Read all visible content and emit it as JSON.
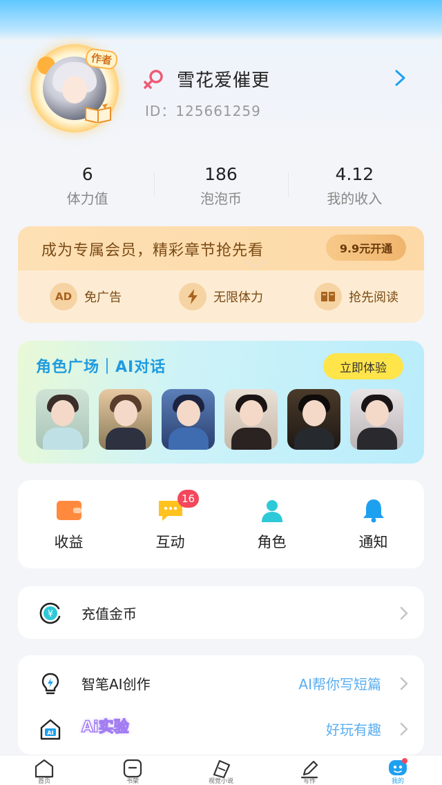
{
  "colors": {
    "accent": "#1ea0f0",
    "vip_text": "#7a4a14",
    "badge_red": "#f4475b",
    "ai_yellow": "#ffe44a",
    "link_blue": "#5aaef0"
  },
  "profile": {
    "avatar_badge": "作者",
    "gender_icon": "female-icon",
    "username": "雪花爱催更",
    "user_id": "ID：125661259"
  },
  "stats": [
    {
      "value": "6",
      "label": "体力值"
    },
    {
      "value": "186",
      "label": "泡泡币"
    },
    {
      "value": "4.12",
      "label": "我的收入"
    }
  ],
  "vip": {
    "title": "成为专属会员，精彩章节抢先看",
    "button": "9.9元开通",
    "perks": [
      {
        "icon_text": "AD",
        "icon": "no-ads-icon",
        "label": "免广告"
      },
      {
        "icon_text": "",
        "icon": "lightning-icon",
        "label": "无限体力"
      },
      {
        "icon_text": "",
        "icon": "book-icon",
        "label": "抢先阅读"
      }
    ]
  },
  "ai_card": {
    "title": "角色广场｜AI对话",
    "button": "立即体验"
  },
  "quick": [
    {
      "label": "收益",
      "icon": "wallet-icon",
      "badge": ""
    },
    {
      "label": "互动",
      "icon": "chat-icon",
      "badge": "16"
    },
    {
      "label": "角色",
      "icon": "person-icon",
      "badge": ""
    },
    {
      "label": "通知",
      "icon": "bell-icon",
      "badge": ""
    }
  ],
  "recharge": {
    "label": "充值金币",
    "icon": "yuan-coin-icon"
  },
  "ai_rows": [
    {
      "label": "智笔AI创作",
      "right": "AI帮你写短篇",
      "icon": "bulb-icon"
    },
    {
      "label": "Ai实验",
      "right": "好玩有趣",
      "icon": "ai-house-icon"
    }
  ],
  "bottom_nav": [
    {
      "label": "首页",
      "icon": "home-icon"
    },
    {
      "label": "书架",
      "icon": "bookshelf-icon"
    },
    {
      "label": "视觉小说",
      "icon": "visual-novel-icon"
    },
    {
      "label": "写作",
      "icon": "pen-icon"
    },
    {
      "label": "我的",
      "icon": "mine-icon",
      "active": true
    }
  ]
}
